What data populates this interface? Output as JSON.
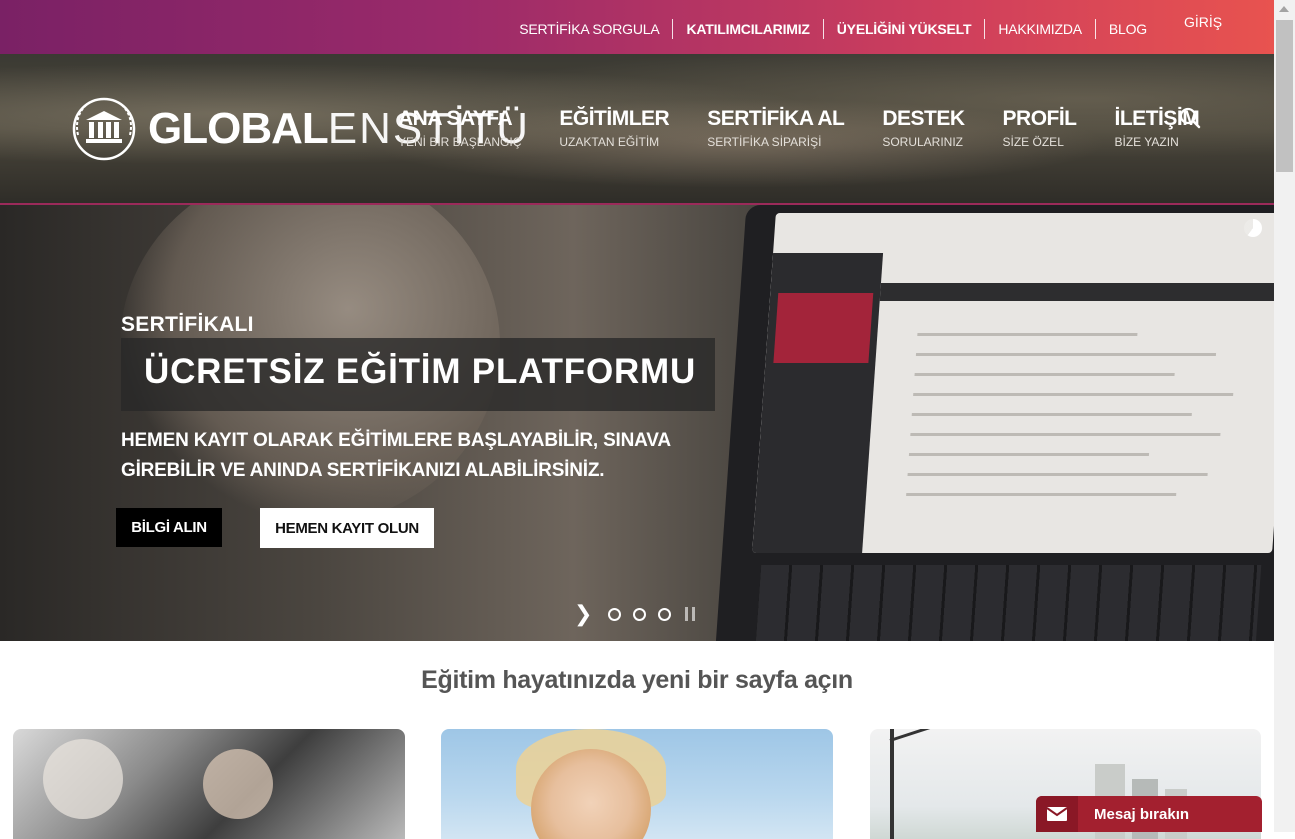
{
  "topbar": {
    "links": [
      "SERTİFİKA SORGULA",
      "KATILIMCILARIMIZ",
      "ÜYELİĞİNİ YÜKSELT",
      "HAKKIMIZDA",
      "BLOG"
    ],
    "login": "GİRİŞ"
  },
  "logo": {
    "bold": "GLOBAL",
    "thin": "ENSTİTÜ"
  },
  "nav": [
    {
      "title": "ANA SAYFA",
      "sub": "YENİ BİR BAŞLANGIÇ"
    },
    {
      "title": "EĞİTİMLER",
      "sub": "UZAKTAN EĞİTİM"
    },
    {
      "title": "SERTİFİKA AL",
      "sub": "SERTİFİKA SİPARİŞİ"
    },
    {
      "title": "DESTEK",
      "sub": "SORULARINIZ"
    },
    {
      "title": "PROFİL",
      "sub": "SİZE ÖZEL"
    },
    {
      "title": "İLETİŞİM",
      "sub": "BİZE YAZIN"
    }
  ],
  "hero": {
    "subtitle": "SERTİFİKALI",
    "title": "ÜCRETSİZ EĞİTİM PLATFORMU",
    "desc_line1": "HEMEN KAYIT OLARAK EĞİTİMLERE BAŞLAYABİLİR, SINAVA",
    "desc_line2": "GİREBİLİR VE ANINDA SERTİFİKANIZI ALABİLİRSİNİZ.",
    "btn_info": "BİLGİ ALIN",
    "btn_register": "HEMEN KAYIT OLUN",
    "slides": 3
  },
  "section": {
    "title": "Eğitim hayatınızda yeni bir sayfa açın"
  },
  "chat": {
    "label": "Mesaj bırakın"
  },
  "colors": {
    "brand_start": "#7a2165",
    "brand_end": "#e8534f",
    "chat": "#a3202f"
  }
}
